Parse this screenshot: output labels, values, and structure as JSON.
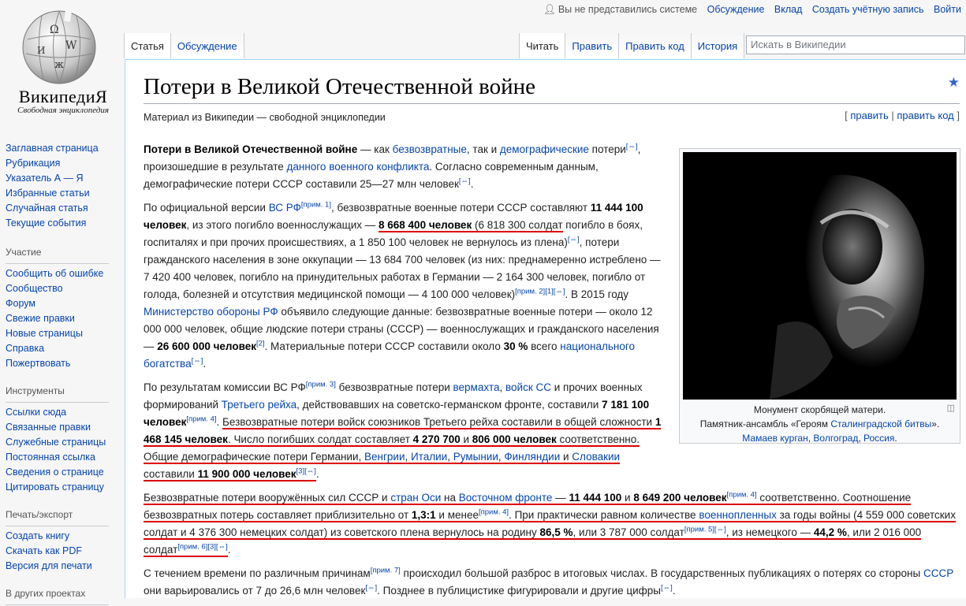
{
  "logo": {
    "wordmark": "ВикипедиЯ",
    "tagline": "Свободная энциклопедия"
  },
  "personal": {
    "not_logged": "Вы не представились системе",
    "talk": "Обсуждение",
    "contributions": "Вклад",
    "create_account": "Создать учётную запись",
    "login": "Войти"
  },
  "tabs": {
    "article": "Статья",
    "discussion": "Обсуждение",
    "read": "Читать",
    "edit": "Править",
    "edit_source": "Править код",
    "history": "История"
  },
  "search": {
    "placeholder": "Искать в Википедии"
  },
  "sidebar": {
    "nav": [
      "Заглавная страница",
      "Рубрикация",
      "Указатель А — Я",
      "Избранные статьи",
      "Случайная статья",
      "Текущие события"
    ],
    "participation_header": "Участие",
    "participation": [
      "Сообщить об ошибке",
      "Сообщество",
      "Форум",
      "Свежие правки",
      "Новые страницы",
      "Справка",
      "Пожертвовать"
    ],
    "tools_header": "Инструменты",
    "tools": [
      "Ссылки сюда",
      "Связанные правки",
      "Служебные страницы",
      "Постоянная ссылка",
      "Сведения о странице",
      "Цитировать страницу"
    ],
    "print_header": "Печать/экспорт",
    "print": [
      "Создать книгу",
      "Скачать как PDF",
      "Версия для печати"
    ],
    "other_header": "В других проектах"
  },
  "article": {
    "title": "Потери в Великой Отечественной войне",
    "from": "Материал из Википедии — свободной энциклопедии",
    "edit": "править",
    "edit_code": "править код",
    "sep": "|",
    "bracket_open": "[",
    "bracket_close": "]"
  },
  "figure": {
    "caption_line1": "Монумент скорбящей матери.",
    "caption_line2a": "Памятник-ансамбль «Героям ",
    "caption_link1": "Сталинградской битвы",
    "caption_line2b": "».",
    "caption_link2": "Мамаев курган",
    "caption_comma": ", ",
    "caption_link3": "Волгоград",
    "caption_link4": "Россия",
    "caption_end": "."
  },
  "p1": {
    "bold": "Потери в Великой Отечественной войне",
    "t1": " — как ",
    "l1": "безвозвратные",
    "t2": ", так и ",
    "l2": "демографические",
    "t3": " потери",
    "s1": "[⇔]",
    "t4": ", произошедшие в результате ",
    "l3": "данного военного конфликта",
    "t5": ". Согласно современным данным, демографические потери СССР составили 25—27 млн человек",
    "s2": "[⇔]",
    "t6": "."
  },
  "p2": {
    "t1": "По официальной версии ",
    "l1": "ВС РФ",
    "s1": "[прим. 1]",
    "t2": ", безвозвратные военные потери СССР составляют ",
    "b1": "11 444 100 человек",
    "t3": ", из этого погибло военнослужащих — ",
    "b2": "8 668 400 человек",
    "u1": " (6 818 300 солдат",
    "t4": " погибло в боях, госпиталях и при прочих происшествиях, а 1 850 100 человек не вернулось из плена)",
    "s2": "[⇔]",
    "t5": ", потери гражданского населения в зоне оккупации — 13 684 700 человек (из них: преднамеренно истреблено — 7 420 400 человек, погибло на принудительных работах в Германии — 2 164 300 человек, погибло от голода, болезней и отсутствия медицинской помощи — 4 100 000 человек)",
    "s3": "[прим. 2][1][⇔]",
    "t6": ". В 2015 году ",
    "l2": "Министерство обороны РФ",
    "t7": " объявило следующие данные: безвозвратные военные потери — около 12 000 000 человек, общие людские потери страны (СССР) — военнослужащих и гражданского населения — ",
    "b3": "26 600 000 человек",
    "s4": "[2]",
    "t8": ". Материальные потери СССР составили около ",
    "b4": "30 %",
    "t9": " всего ",
    "l3": "национального богатства",
    "s5": "[⇔]",
    "t10": "."
  },
  "p3": {
    "t1": "По результатам комиссии ВС РФ",
    "s1": "[прим. 3]",
    "t2": " безвозвратные потери ",
    "l1": "вермахта",
    "t3": ", ",
    "l2": "войск СС",
    "t4": " и прочих военных формирований ",
    "l3": "Третьего рейха",
    "t5": ", действовавших на советско-германском фронте, составили ",
    "b1": "7 181 100 человек",
    "s2": "[прим. 4]",
    "t6": ". ",
    "u1": "Безвозвратные потери войск союзников Третьего рейха составили в общей сложности ",
    "b2": "1 468 145 человек",
    "u2": ". Число погибших солдат составляет ",
    "b3": "4 270 700",
    "u3": " и ",
    "b4": "806 000 человек",
    "u4": " соответственно. Общие демографические потери Германии, ",
    "l4": "Венгрии",
    "u5": ", ",
    "l5": "Италии",
    "u6": ", ",
    "l6": "Румынии",
    "l7": "Финляндии",
    "u7": " и ",
    "l8": "Словакии",
    "u8": " составили ",
    "b5": "11 900 000 человек",
    "s3": "[3][⇔]",
    "t7": "."
  },
  "p4": {
    "u1": "Безвозвратные потери вооружённых сил СССР и ",
    "l1": "стран Оси",
    "u2": " на ",
    "l2": "Восточном фронте",
    "u3": " — ",
    "b1": "11 444 100",
    "u4": " и ",
    "b2": "8 649 200 человек",
    "s1": "[прим. 4]",
    "u5": " соответственно. Соотношение безвозвратных потерь составляет приблизительно от ",
    "b3": "1,3:1",
    "u6": " и менее",
    "s2": "[прим. 4]",
    "u7": ". При практически равном количестве ",
    "l3": "военнопленных",
    "u8": " за годы войны (4 559 000 советских солдат и 4 376 300 немецких солдат) из советского плена вернулось на родину ",
    "b4": "86,5 %",
    "u9": ", или 3 787 000 солдат",
    "s3": "[прим. 5][⇔]",
    "u10": ", из немецкого — ",
    "b5": "44,2 %",
    "u11": ", или 2 016 000 солдат",
    "s4": "[прим. 6][3][⇔]",
    "t1": "."
  },
  "p5": {
    "t1": "С течением времени по различным причинам",
    "s1": "[прим. 7]",
    "t2": " происходил большой разброс в итоговых числах. В государственных публикациях о потерях со стороны ",
    "l1": "СССР",
    "t3": " они варьировались от 7 до 26,6 млн человек",
    "s2": "[⇔]",
    "t4": ". Позднее в публицистике фигурировали и другие цифры",
    "s3": "[⇔]",
    "t5": "."
  }
}
